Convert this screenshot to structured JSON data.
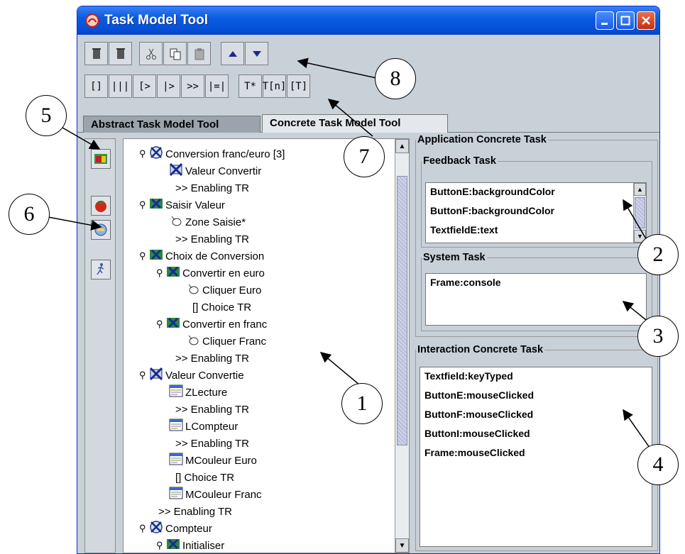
{
  "window": {
    "title": "Task Model Tool",
    "controls": [
      "minimize",
      "maximize",
      "close"
    ]
  },
  "toolbar": {
    "row1": [
      "trash-icon",
      "trash-icon",
      "cut-icon",
      "copy-icon",
      "paste-icon",
      "arrow-up-icon",
      "arrow-down-icon"
    ],
    "row2": [
      "[]",
      "|||",
      "[>",
      "|>",
      ">>",
      "|=|",
      "T*",
      "T[n]",
      "[T]"
    ]
  },
  "tabs": {
    "abstract": "Abstract Task Model Tool",
    "concrete": "Concrete Task Model Tool"
  },
  "tree": {
    "items": [
      {
        "label": "Conversion franc/euro [3]",
        "icon": "abstract-task-icon"
      },
      {
        "label": "Valeur Convertir",
        "icon": "system-task-icon"
      },
      {
        "label": ">> Enabling TR",
        "icon": "operator"
      },
      {
        "label": "Saisir Valeur",
        "icon": "interaction-task-icon"
      },
      {
        "label": "Zone Saisie*",
        "icon": "hand-pointer-icon"
      },
      {
        "label": ">> Enabling TR",
        "icon": "operator"
      },
      {
        "label": "Choix de Conversion",
        "icon": "interaction-task-icon"
      },
      {
        "label": "Convertir en euro",
        "icon": "interaction-task-icon"
      },
      {
        "label": "Cliquer Euro",
        "icon": "hand-pointer-icon"
      },
      {
        "label": "[] Choice TR",
        "icon": "operator"
      },
      {
        "label": "Convertir en franc",
        "icon": "interaction-task-icon"
      },
      {
        "label": "Cliquer Franc",
        "icon": "hand-pointer-icon"
      },
      {
        "label": ">> Enabling TR",
        "icon": "operator"
      },
      {
        "label": "Valeur Convertie",
        "icon": "system-task-icon"
      },
      {
        "label": "ZLecture",
        "icon": "window-icon"
      },
      {
        "label": ">> Enabling TR",
        "icon": "operator"
      },
      {
        "label": "LCompteur",
        "icon": "window-icon"
      },
      {
        "label": ">> Enabling TR",
        "icon": "operator"
      },
      {
        "label": "MCouleur Euro",
        "icon": "window-icon"
      },
      {
        "label": "[] Choice TR",
        "icon": "operator"
      },
      {
        "label": "MCouleur Franc",
        "icon": "window-icon"
      },
      {
        "label": ">> Enabling TR",
        "icon": "operator"
      },
      {
        "label": "Compteur",
        "icon": "abstract-task-icon"
      },
      {
        "label": "Initialiser",
        "icon": "interaction-task-icon"
      }
    ]
  },
  "right": {
    "app_title": "Application Concrete Task",
    "feedback_title": "Feedback Task",
    "feedback_items": [
      "ButtonE:backgroundColor",
      "ButtonF:backgroundColor",
      "TextfieldE:text"
    ],
    "system_title": "System Task",
    "system_items": [
      "Frame:console"
    ],
    "interaction_title": "Interaction Concrete Task",
    "interaction_items": [
      "Textfield:keyTyped",
      "ButtonE:mouseClicked",
      "ButtonF:mouseClicked",
      "ButtonI:mouseClicked",
      "Frame:mouseClicked"
    ]
  },
  "callouts": [
    "1",
    "2",
    "3",
    "4",
    "5",
    "6",
    "7",
    "8"
  ]
}
